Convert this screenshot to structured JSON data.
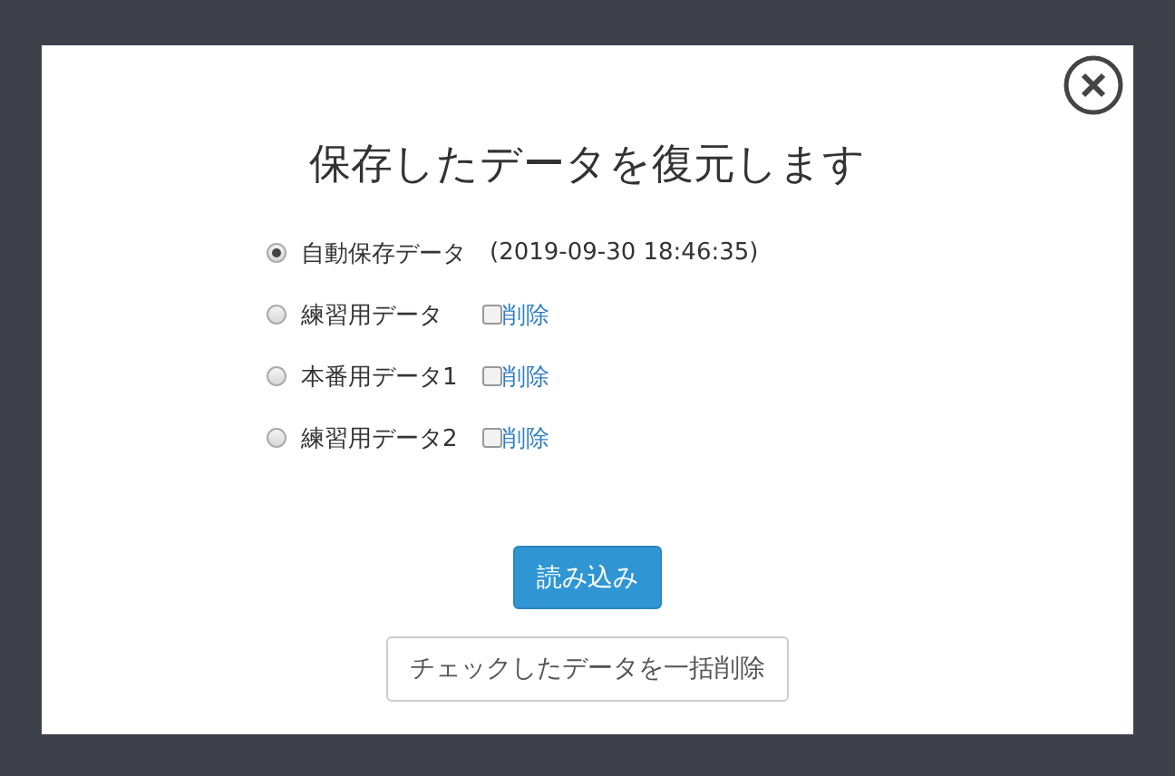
{
  "dialog": {
    "title": "保存したデータを復元します",
    "entries": [
      {
        "label": "自動保存データ",
        "timestamp": "(2019-09-30 18:46:35)",
        "selected": true
      },
      {
        "label": "練習用データ",
        "selected": false,
        "delete": {
          "label": "削除",
          "checked": false
        }
      },
      {
        "label": "本番用データ1",
        "selected": false,
        "delete": {
          "label": "削除",
          "checked": false
        }
      },
      {
        "label": "練習用データ2",
        "selected": false,
        "delete": {
          "label": "削除",
          "checked": false
        }
      }
    ],
    "load_button": "読み込み",
    "bulk_delete_button": "チェックしたデータを一括削除"
  }
}
